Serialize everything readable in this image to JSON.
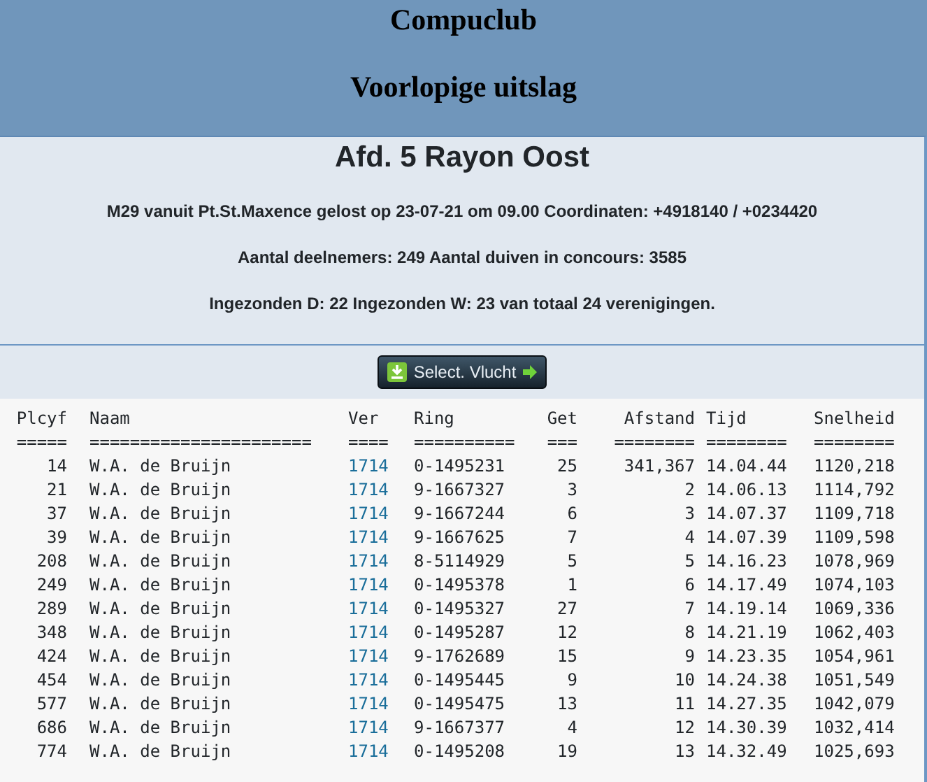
{
  "header": {
    "site_title": "Compuclub",
    "page_title": "Voorlopige uitslag"
  },
  "info": {
    "title": "Afd. 5 Rayon Oost",
    "lines": [
      "M29 vanuit Pt.St.Maxence gelost op 23-07-21 om 09.00 Coordinaten: +4918140 / +0234420",
      "Aantal deelnemers: 249 Aantal duiven in concours: 3585",
      "Ingezonden D: 22 Ingezonden W: 23 van totaal 24 verenigingen."
    ]
  },
  "select_button": {
    "label": "Select. Vlucht"
  },
  "table": {
    "columns": [
      "Plcyf",
      "Naam",
      "Ver",
      "Ring",
      "Get",
      "Afstand",
      "Tijd",
      "Snelheid"
    ],
    "separators": [
      "=====",
      "======================",
      "====",
      "==========",
      "===",
      "========",
      "========",
      "========"
    ],
    "rows": [
      [
        "14",
        "W.A. de Bruijn",
        "1714",
        "0-1495231",
        "25",
        "341,367",
        "14.04.44",
        "1120,218"
      ],
      [
        "21",
        "W.A. de Bruijn",
        "1714",
        "9-1667327",
        "3",
        "2",
        "14.06.13",
        "1114,792"
      ],
      [
        "37",
        "W.A. de Bruijn",
        "1714",
        "9-1667244",
        "6",
        "3",
        "14.07.37",
        "1109,718"
      ],
      [
        "39",
        "W.A. de Bruijn",
        "1714",
        "9-1667625",
        "7",
        "4",
        "14.07.39",
        "1109,598"
      ],
      [
        "208",
        "W.A. de Bruijn",
        "1714",
        "8-5114929",
        "5",
        "5",
        "14.16.23",
        "1078,969"
      ],
      [
        "249",
        "W.A. de Bruijn",
        "1714",
        "0-1495378",
        "1",
        "6",
        "14.17.49",
        "1074,103"
      ],
      [
        "289",
        "W.A. de Bruijn",
        "1714",
        "0-1495327",
        "27",
        "7",
        "14.19.14",
        "1069,336"
      ],
      [
        "348",
        "W.A. de Bruijn",
        "1714",
        "0-1495287",
        "12",
        "8",
        "14.21.19",
        "1062,403"
      ],
      [
        "424",
        "W.A. de Bruijn",
        "1714",
        "9-1762689",
        "15",
        "9",
        "14.23.35",
        "1054,961"
      ],
      [
        "454",
        "W.A. de Bruijn",
        "1714",
        "0-1495445",
        "9",
        "10",
        "14.24.38",
        "1051,549"
      ],
      [
        "577",
        "W.A. de Bruijn",
        "1714",
        "0-1495475",
        "13",
        "11",
        "14.27.35",
        "1042,079"
      ],
      [
        "686",
        "W.A. de Bruijn",
        "1714",
        "9-1667377",
        "4",
        "12",
        "14.30.39",
        "1032,414"
      ],
      [
        "774",
        "W.A. de Bruijn",
        "1714",
        "0-1495208",
        "19",
        "13",
        "14.32.49",
        "1025,693"
      ]
    ]
  }
}
